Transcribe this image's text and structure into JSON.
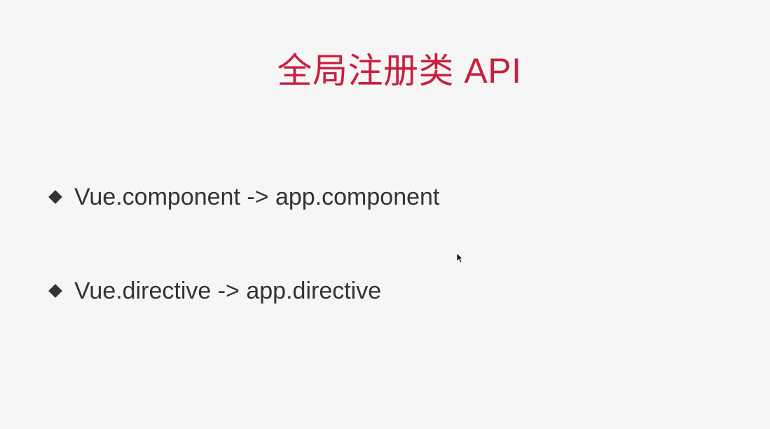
{
  "slide": {
    "title": "全局注册类 API",
    "bullets": [
      "Vue.component -> app.component",
      "Vue.directive -> app.directive"
    ],
    "colors": {
      "background": "#f6f6f6",
      "title": "#c8203f",
      "text": "#333333"
    },
    "icons": {
      "bullet": "diamond-bullet-icon",
      "pointer": "mouse-pointer-icon"
    }
  }
}
